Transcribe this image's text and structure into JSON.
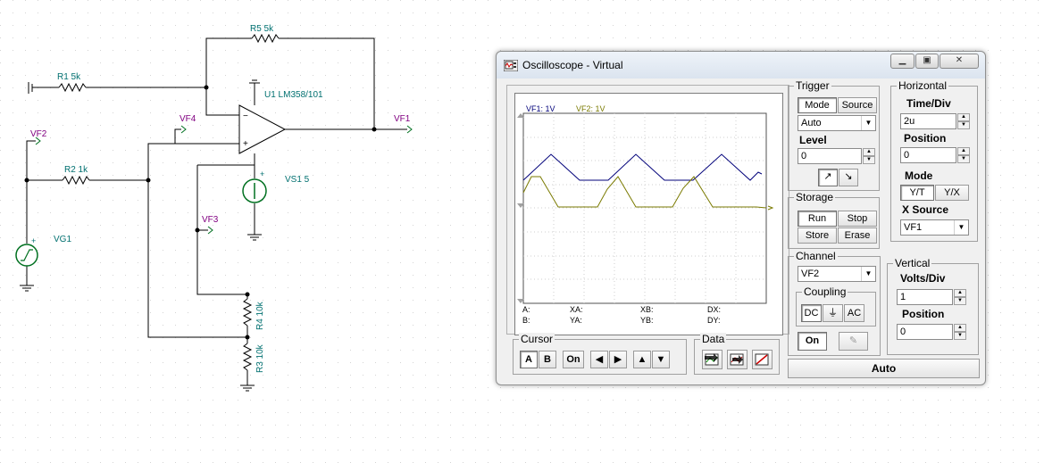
{
  "schematic": {
    "components": {
      "r5": "R5 5k",
      "r1": "R1 5k",
      "u1": "U1 LM358/101",
      "r2": "R2 1k",
      "vs1": "VS1 5",
      "vg1": "VG1",
      "r4": "R4 10k",
      "r3": "R3 10k"
    },
    "nodes": {
      "vf1": "VF1",
      "vf2": "VF2",
      "vf3": "VF3",
      "vf4": "VF4"
    }
  },
  "oscilloscope": {
    "title": "Oscilloscope - Virtual",
    "screen": {
      "legend_ch1": "VF1: 1V",
      "legend_ch2": "VF2: 1V",
      "ch1_color": "#00007a",
      "ch2_color": "#7a7a00",
      "cursor_labels": {
        "a": "A:",
        "b": "B:",
        "xa": "XA:",
        "ya": "YA:",
        "xb": "XB:",
        "yb": "YB:",
        "dx": "DX:",
        "dy": "DY:"
      }
    },
    "trigger": {
      "title": "Trigger",
      "mode_button": "Mode",
      "source_button": "Source",
      "mode_value": "Auto",
      "level_label": "Level",
      "level_value": "0"
    },
    "horizontal": {
      "title": "Horizontal",
      "time_div_label": "Time/Div",
      "time_div_value": "2u",
      "position_label": "Position",
      "position_value": "0",
      "mode_label": "Mode",
      "mode_yt": "Y/T",
      "mode_yx": "Y/X",
      "x_source_label": "X Source",
      "x_source_value": "VF1"
    },
    "storage": {
      "title": "Storage",
      "run": "Run",
      "stop": "Stop",
      "store": "Store",
      "erase": "Erase"
    },
    "channel": {
      "title": "Channel",
      "value": "VF2",
      "coupling_title": "Coupling",
      "dc": "DC",
      "ac": "AC",
      "on": "On"
    },
    "vertical": {
      "title": "Vertical",
      "volts_div_label": "Volts/Div",
      "volts_div_value": "1",
      "position_label": "Position",
      "position_value": "0"
    },
    "cursor": {
      "title": "Cursor",
      "a": "A",
      "b": "B",
      "on": "On"
    },
    "data": {
      "title": "Data"
    },
    "auto_button": "Auto"
  }
}
